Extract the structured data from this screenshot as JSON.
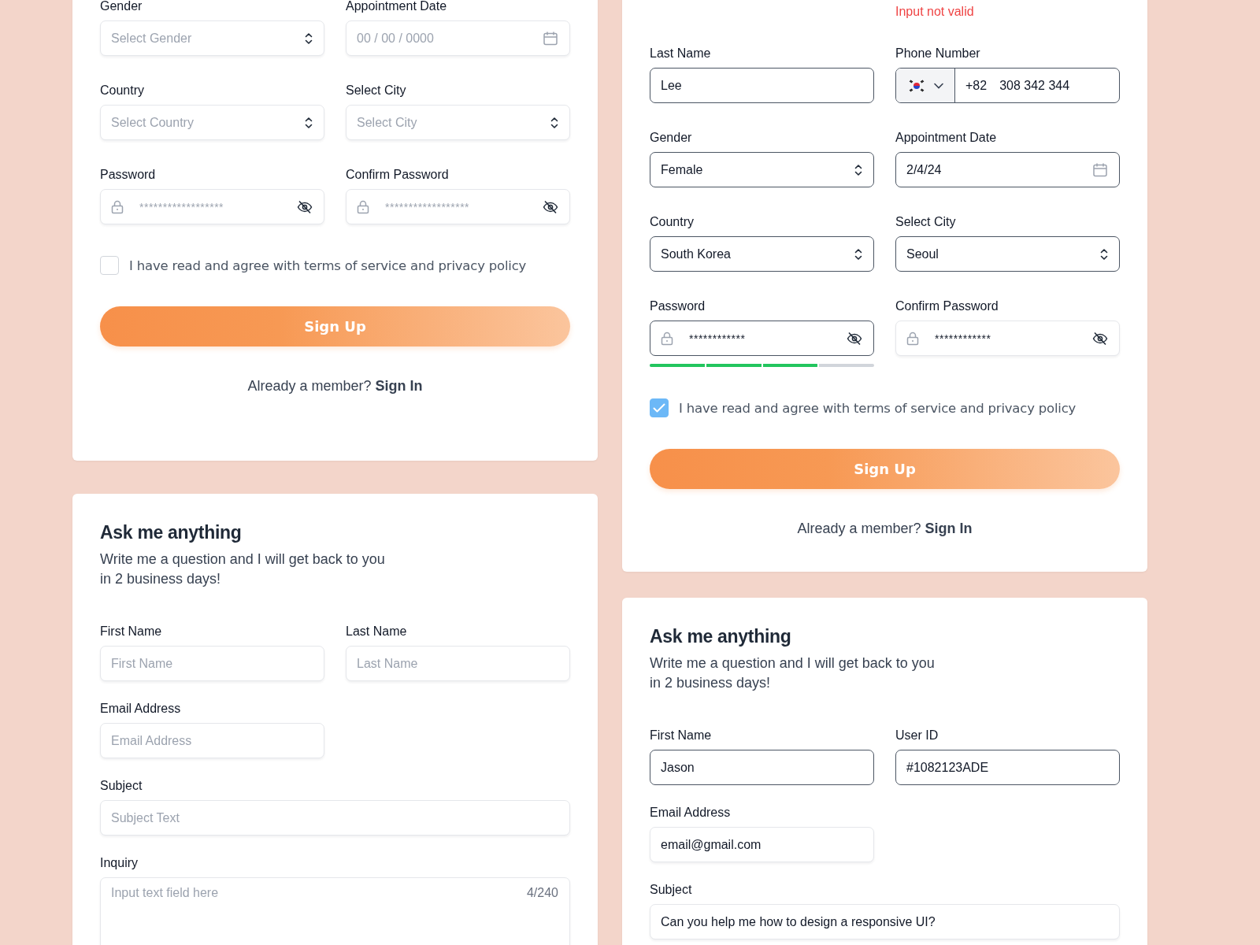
{
  "columns": [
    {
      "cards": [
        {
          "kind": "signup",
          "fields": [
            {
              "kind": "select",
              "label": "Gender",
              "placeholder": "Select Gender",
              "highlighted": false
            },
            {
              "kind": "date",
              "label": "Appointment Date",
              "placeholder": "00 / 00 / 0000",
              "highlighted": false
            },
            {
              "kind": "select",
              "label": "Country",
              "placeholder": "Select Country",
              "highlighted": false
            },
            {
              "kind": "select",
              "label": "Select City",
              "placeholder": "Select City",
              "highlighted": false
            },
            {
              "kind": "password",
              "label": "Password",
              "placeholder": "******************",
              "highlighted": false
            },
            {
              "kind": "password",
              "label": "Confirm Password",
              "placeholder": "******************",
              "highlighted": false
            }
          ],
          "agreement": {
            "label": "I have read and agree with terms of service and privacy policy",
            "checked": false
          },
          "button": "Sign Up",
          "footer": {
            "text": "Already a member?",
            "link": "Sign In"
          }
        },
        {
          "kind": "contact",
          "title": "Ask me anything",
          "subtitle": "Write me a question and I will get back to you in 2 business days!",
          "fields": [
            {
              "kind": "text",
              "label": "First Name",
              "placeholder": "First Name",
              "highlighted": false
            },
            {
              "kind": "text",
              "label": "Last Name",
              "placeholder": "Last Name",
              "highlighted": false
            },
            {
              "kind": "text",
              "label": "Email Address",
              "placeholder": "Email Address",
              "highlighted": false
            },
            {
              "kind": "text",
              "label": "Subject",
              "placeholder": "Subject Text",
              "highlighted": false,
              "wide": true
            },
            {
              "kind": "textarea",
              "label": "Inquiry",
              "placeholder": "Input text field here",
              "counter": "4/240",
              "highlighted": false,
              "wide": true
            }
          ]
        }
      ]
    },
    {
      "cards": [
        {
          "kind": "signup",
          "error": "Input not valid",
          "fields": [
            {
              "kind": "text",
              "label": "Last Name",
              "value": "Lee",
              "highlighted": true
            },
            {
              "kind": "phone",
              "label": "Phone Number",
              "code": "+82",
              "value": "308 342 344",
              "highlighted": true
            },
            {
              "kind": "select",
              "label": "Gender",
              "value": "Female",
              "highlighted": true
            },
            {
              "kind": "date",
              "label": "Appointment Date",
              "value": "2/4/24",
              "highlighted": true
            },
            {
              "kind": "select",
              "label": "Country",
              "value": "South Korea",
              "highlighted": true
            },
            {
              "kind": "select",
              "label": "Select City",
              "value": "Seoul",
              "highlighted": true
            },
            {
              "kind": "password",
              "label": "Password",
              "value": "************",
              "highlighted": true,
              "strength": {
                "level": 0.75
              }
            },
            {
              "kind": "password",
              "label": "Confirm Password",
              "value": "************",
              "highlighted": false
            }
          ],
          "agreement": {
            "label": "I have read and agree with terms of service and privacy policy",
            "checked": true
          },
          "button": "Sign Up",
          "footer": {
            "text": "Already a member?",
            "link": "Sign In"
          }
        },
        {
          "kind": "contact",
          "title": "Ask me anything",
          "subtitle": "Write me a question and I will get back to you in 2 business days!",
          "fields": [
            {
              "kind": "text",
              "label": "First Name",
              "value": "Jason",
              "highlighted": true
            },
            {
              "kind": "text",
              "label": "User ID",
              "value": "#1082123ADE",
              "highlighted": true
            },
            {
              "kind": "text",
              "label": "Email Address",
              "value": "email@gmail.com",
              "highlighted": false
            },
            {
              "kind": "text",
              "label": "Subject",
              "value": "Can you help me how to design a responsive UI?",
              "highlighted": false,
              "wide": true
            }
          ]
        }
      ]
    }
  ]
}
